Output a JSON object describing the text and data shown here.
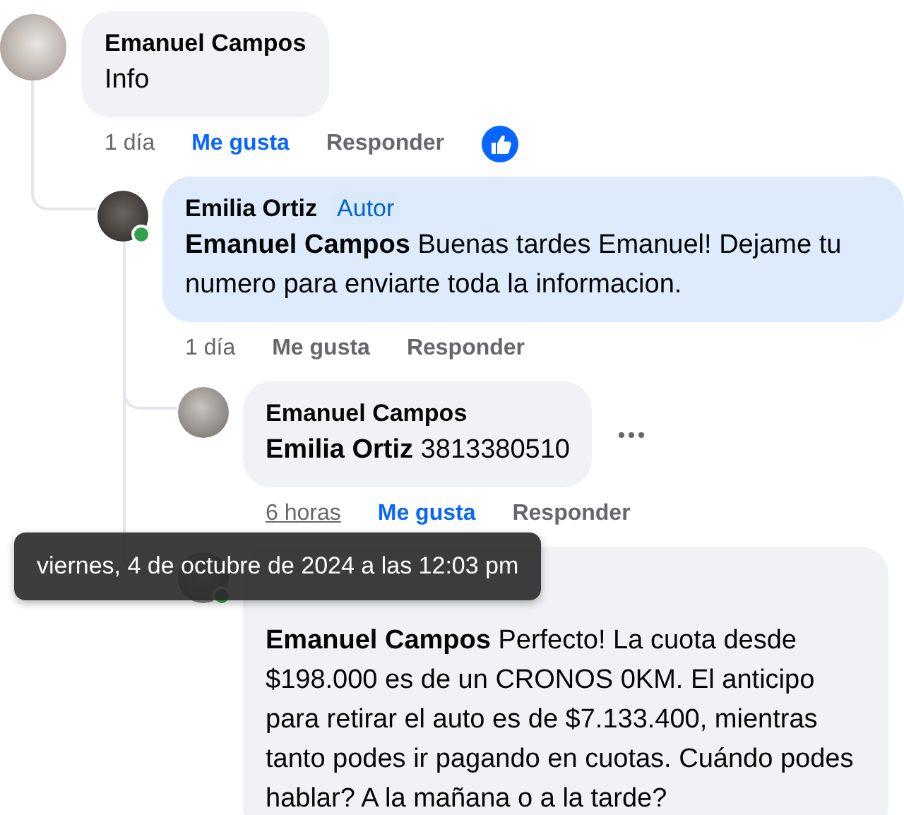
{
  "comments": [
    {
      "author": "Emanuel Campos",
      "highlighted": false,
      "text": "Info",
      "time": "1 día",
      "hovered": false,
      "like_label": "Me gusta",
      "liked": true,
      "reply_label": "Responder",
      "thumbs_up": true,
      "children": [
        {
          "author": "Emilia Ortiz",
          "badge": "Autor",
          "online": true,
          "highlighted": true,
          "text": "**Emanuel Campos** Buenas tardes Emanuel! Dejame tu numero para enviarte toda la informacion.",
          "time": "1 día",
          "hovered": false,
          "like_label": "Me gusta",
          "liked": false,
          "reply_label": "Responder",
          "children": [
            {
              "author": "Emanuel Campos",
              "highlighted": false,
              "text": "**Emilia Ortiz** 3813380510",
              "time": "6 horas",
              "hovered": true,
              "like_label": "Me gusta",
              "liked": true,
              "reply_label": "Responder",
              "show_menu": true
            },
            {
              "online": true,
              "highlighted": false,
              "text": "**Emanuel Campos** Perfecto! La cuota desde $198.000 es de un CRONOS 0KM. El anticipo para retirar el auto es de $7.133.400, mientras tanto podes ir pagando en cuotas. Cuándo podes hablar? A la mañana o a la tarde?"
            }
          ]
        }
      ]
    }
  ],
  "tooltip": {
    "text": "viernes, 4 de octubre de 2024 a las 12:03 pm"
  }
}
